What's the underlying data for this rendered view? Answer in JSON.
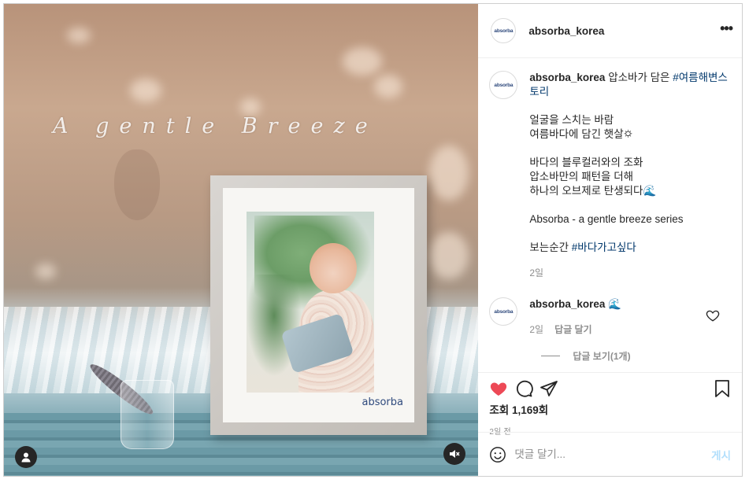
{
  "media": {
    "headline": "A gentle Breeze",
    "frame_logo": "absorba"
  },
  "account": {
    "username": "absorba_korea",
    "avatar_text": "absorba"
  },
  "caption": {
    "username": "absorba_korea",
    "text": "압소바가 담은 ",
    "tag1": "#여름해변스토리",
    "lines_1": [
      "얼굴을 스치는 바람",
      "여름바다에 담긴 햇살🌣"
    ],
    "lines_2": [
      "바다의 블루컬러와의 조화",
      "압소바만의 패턴을 더해",
      "하나의 오브제로 탄생되다🌊"
    ],
    "line_3": "Absorba - a gentle breeze series",
    "line_4_text": "보는순간 ",
    "tag2": "#바다가고싶다",
    "time": "2일"
  },
  "comment": {
    "username": "absorba_korea",
    "text": "🌊",
    "time": "2일",
    "reply_label": "답글 달기",
    "view_replies": "답글 보기(1개)"
  },
  "actions": {
    "views": "조회 1,169회",
    "date": "2일 전",
    "liked": true,
    "like_color": "#ed4956"
  },
  "composer": {
    "placeholder": "댓글 달기...",
    "post_label": "게시"
  },
  "icons": [
    "user-icon",
    "mute-icon",
    "more-icon",
    "heart-icon",
    "comment-icon",
    "share-icon",
    "bookmark-icon",
    "emoji-icon"
  ]
}
